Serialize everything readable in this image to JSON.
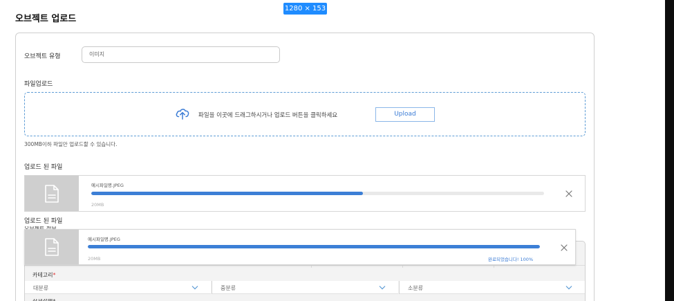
{
  "badge": {
    "dimensions": "1280 × 153"
  },
  "page": {
    "title": "오브젝트 업로드"
  },
  "object_type": {
    "label": "오브젝트 유형",
    "value": "이미지"
  },
  "upload": {
    "title": "파일업로드",
    "drop_text": "파일을 이곳에 드래그하시거나 업로드 버튼을 클릭하세요",
    "button_label": "Upload",
    "limit_note": "300MB이하 파일만 업로드할 수 있습니다.",
    "icon": "cloud-upload-icon"
  },
  "uploaded_files": {
    "title": "업로드 된 파일",
    "items": [
      {
        "name": "예시파일명.JPEG",
        "size": "20MB",
        "progress": 0.6,
        "status": ""
      },
      {
        "name": "예시파일명.JPEG",
        "size": "20MB",
        "progress": 1.0,
        "status": "완료되었습니다! 100%"
      }
    ]
  },
  "second_uploaded_title": "업로드 된 파일",
  "peek_label": "오브젝트 정보",
  "category": {
    "label": "카테고리",
    "required_mark": "*",
    "selects": [
      {
        "label": "대분류"
      },
      {
        "label": "중분류"
      },
      {
        "label": "소분류"
      }
    ]
  },
  "bottom_peek_label": "상세설명*",
  "colors": {
    "accent": "#3c7fd6",
    "dropzone_border": "#5b9bd5",
    "required": "#e03030",
    "badge": "#1f8cff"
  }
}
